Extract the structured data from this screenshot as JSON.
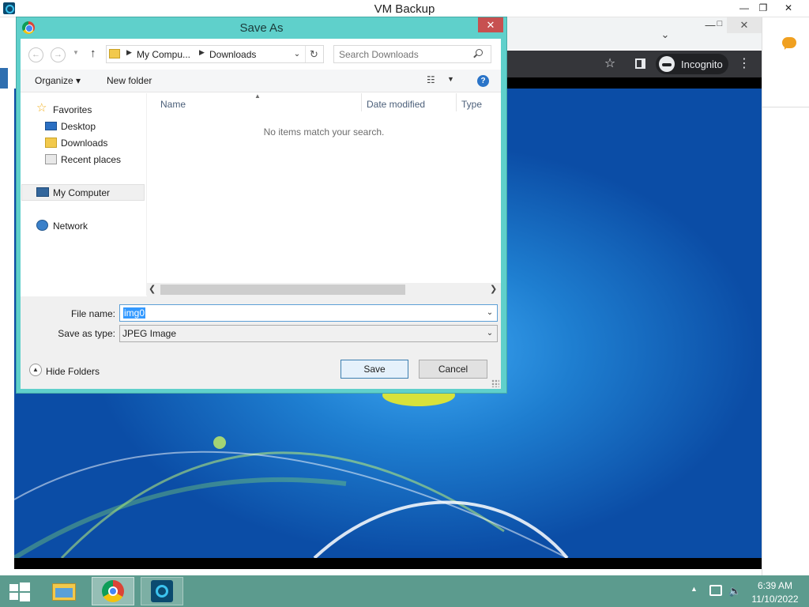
{
  "vm_window": {
    "title": "VM Backup",
    "minimize": "—",
    "restore": "❐",
    "close": "✕"
  },
  "chrome": {
    "incognito_label": "Incognito",
    "star": "☆",
    "menu": "⋮",
    "min": "—",
    "max": "□",
    "close": "✕",
    "chevron": "⌄"
  },
  "dialog": {
    "title": "Save As",
    "close": "✕",
    "address": {
      "crumbs": [
        "My Compu...",
        "Downloads"
      ]
    },
    "search": {
      "placeholder": "Search Downloads"
    },
    "toolbar": {
      "organize_label": "Organize ▾",
      "new_folder_label": "New folder"
    },
    "nav_pane": {
      "favorites": "Favorites",
      "desktop": "Desktop",
      "downloads": "Downloads",
      "recent_places": "Recent places",
      "my_computer": "My Computer",
      "network": "Network"
    },
    "file_list": {
      "columns": [
        "Name",
        "Date modified",
        "Type"
      ],
      "empty_message": "No items match your search."
    },
    "form": {
      "file_name_label": "File name:",
      "file_name_value": "img0",
      "save_type_label": "Save as type:",
      "save_type_value": "JPEG Image"
    },
    "buttons": {
      "hide_folders": "Hide Folders",
      "save": "Save",
      "cancel": "Cancel"
    }
  },
  "taskbar": {
    "clock_time": "6:39 AM",
    "clock_date": "11/10/2022"
  },
  "colors": {
    "dialog_frame": "#5fd0cb",
    "close_red": "#c75050",
    "taskbar": "#5c9b8e",
    "selection": "#3399ff"
  },
  "icons": [
    "vm-app-icon",
    "chrome-icon",
    "search-icon",
    "refresh-icon",
    "up-arrow-icon",
    "back-icon",
    "forward-icon",
    "help-icon",
    "star-icon",
    "incognito-icon",
    "windows-start-icon",
    "file-explorer-icon",
    "volume-icon",
    "network-icon"
  ]
}
